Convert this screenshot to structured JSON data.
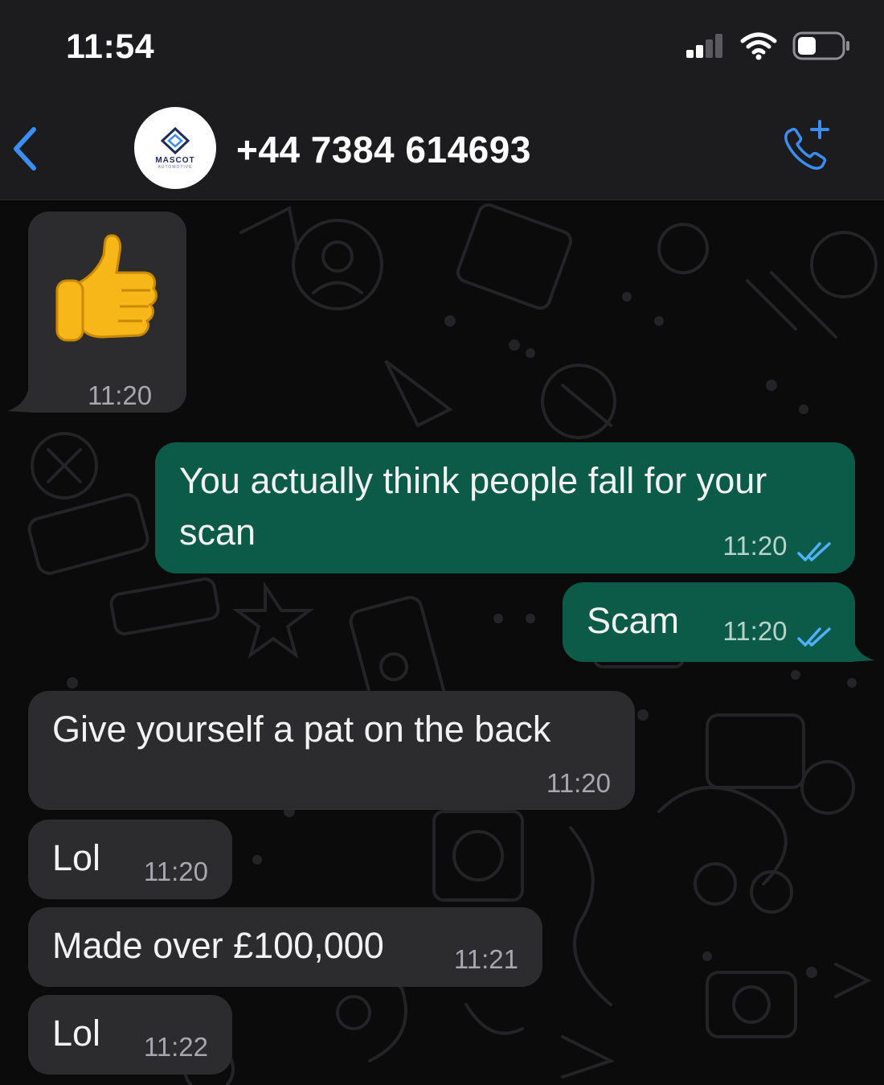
{
  "status_bar": {
    "time": "11:54"
  },
  "header": {
    "contact": "+44 7384 614693",
    "avatar_logo_text": "MASCOT",
    "avatar_logo_subtext": "AUTOMOTIVE"
  },
  "messages": [
    {
      "direction": "incoming",
      "text": "👍",
      "time": "11:20"
    },
    {
      "direction": "outgoing",
      "text_line1": "You actually think people fall for your",
      "text_line2": "scan",
      "time": "11:20",
      "status": "read"
    },
    {
      "direction": "outgoing",
      "text": "Scam",
      "time": "11:20",
      "status": "read"
    },
    {
      "direction": "incoming",
      "text": "Give yourself a pat on the back",
      "time": "11:20"
    },
    {
      "direction": "incoming",
      "text": "Lol",
      "time": "11:20"
    },
    {
      "direction": "incoming",
      "text": "Made over £100,000",
      "time": "11:21"
    },
    {
      "direction": "incoming",
      "text": "Lol",
      "time": "11:22"
    }
  ],
  "colors": {
    "header_bg": "#1c1c1e",
    "incoming_bubble": "#2c2c2e",
    "outgoing_bubble": "#0c5b49",
    "accent_blue": "#3a8ef6",
    "read_ticks": "#4fb0ff"
  },
  "icons": [
    "back-chevron-icon",
    "add-call-icon",
    "signal-icon",
    "wifi-icon",
    "battery-icon",
    "double-check-icon"
  ]
}
